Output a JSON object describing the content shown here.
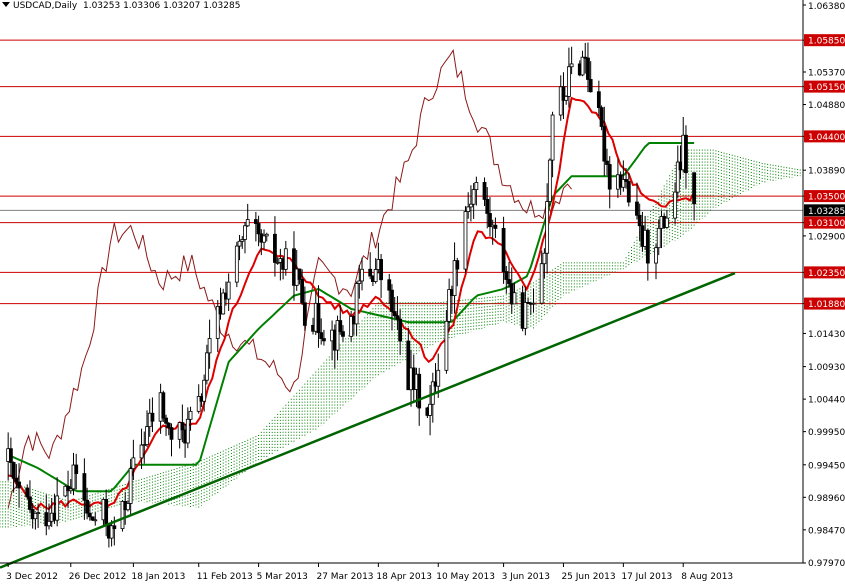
{
  "header": {
    "symbol": "USDCAD,Daily",
    "ohlc": "1.03253 1.03306 1.03207 1.03285"
  },
  "chart_data": {
    "type": "candlestick",
    "title": "USDCAD,Daily",
    "ylim": [
      0.9797,
      1.0638
    ],
    "price_ticks": [
      "1.06380",
      "1.05850",
      "1.05370",
      "1.05150",
      "1.04880",
      "1.04400",
      "1.03890",
      "1.03500",
      "1.03285",
      "1.03100",
      "1.02900",
      "1.02350",
      "1.01880",
      "1.01430",
      "1.00930",
      "1.00440",
      "0.99950",
      "0.99450",
      "0.98960",
      "0.98470",
      "0.97970"
    ],
    "date_ticks": [
      "3 Dec 2012",
      "26 Dec 2012",
      "18 Jan 2013",
      "11 Feb 2013",
      "5 Mar 2013",
      "27 Mar 2013",
      "18 Apr 2013",
      "10 May 2013",
      "3 Jun 2013",
      "25 Jun 2013",
      "17 Jul 2013",
      "8 Aug 2013"
    ],
    "horizontal_levels": [
      {
        "price": 1.0585,
        "label": "1.05850"
      },
      {
        "price": 1.0515,
        "label": "1.05150"
      },
      {
        "price": 1.044,
        "label": "1.04400"
      },
      {
        "price": 1.035,
        "label": "1.03500"
      },
      {
        "price": 1.031,
        "label": "1.03100"
      },
      {
        "price": 1.0235,
        "label": "1.02350"
      },
      {
        "price": 1.0188,
        "label": "1.01880"
      }
    ],
    "current_price": {
      "price": 1.03285,
      "label": "1.03285"
    },
    "trendline": [
      {
        "date": "30 Nov 2012",
        "price": 0.979
      },
      {
        "date": "27 Aug 2013",
        "price": 1.0234
      }
    ],
    "candles_anchor_close": [
      [
        "3 Dec 2012",
        0.995
      ],
      [
        "6 Dec 2012",
        0.9905
      ],
      [
        "11 Dec 2012",
        0.987
      ],
      [
        "14 Dec 2012",
        0.986
      ],
      [
        "19 Dec 2012",
        0.988
      ],
      [
        "26 Dec 2012",
        0.9915
      ],
      [
        "28 Dec 2012",
        0.993
      ],
      [
        "2 Jan 2013",
        0.986
      ],
      [
        "7 Jan 2013",
        0.987
      ],
      [
        "10 Jan 2013",
        0.984
      ],
      [
        "14 Jan 2013",
        0.987
      ],
      [
        "18 Jan 2013",
        0.994
      ],
      [
        "23 Jan 2013",
        1.0
      ],
      [
        "28 Jan 2013",
        1.004
      ],
      [
        "31 Jan 2013",
        0.999
      ],
      [
        "5 Feb 2013",
        0.999
      ],
      [
        "11 Feb 2013",
        1.003
      ],
      [
        "15 Feb 2013",
        1.012
      ],
      [
        "20 Feb 2013",
        1.02
      ],
      [
        "26 Feb 2013",
        1.027
      ],
      [
        "1 Mar 2013",
        1.03
      ],
      [
        "5 Mar 2013",
        1.028
      ],
      [
        "8 Mar 2013",
        1.027
      ],
      [
        "13 Mar 2013",
        1.025
      ],
      [
        "18 Mar 2013",
        1.024
      ],
      [
        "22 Mar 2013",
        1.018
      ],
      [
        "27 Mar 2013",
        1.016
      ],
      [
        "2 Apr 2013",
        1.014
      ],
      [
        "8 Apr 2013",
        1.016
      ],
      [
        "12 Apr 2013",
        1.023
      ],
      [
        "18 Apr 2013",
        1.024
      ],
      [
        "23 Apr 2013",
        1.018
      ],
      [
        "29 Apr 2013",
        1.008
      ],
      [
        "3 May 2013",
        1.005
      ],
      [
        "7 May 2013",
        1.003
      ],
      [
        "10 May 2013",
        1.01
      ],
      [
        "15 May 2013",
        1.022
      ],
      [
        "20 May 2013",
        1.033
      ],
      [
        "24 May 2013",
        1.037
      ],
      [
        "29 May 2013",
        1.031
      ],
      [
        "3 Jun 2013",
        1.025
      ],
      [
        "7 Jun 2013",
        1.018
      ],
      [
        "12 Jun 2013",
        1.017
      ],
      [
        "18 Jun 2013",
        1.028
      ],
      [
        "21 Jun 2013",
        1.048
      ],
      [
        "25 Jun 2013",
        1.05
      ],
      [
        "28 Jun 2013",
        1.054
      ],
      [
        "3 Jul 2013",
        1.056
      ],
      [
        "9 Jul 2013",
        1.044
      ],
      [
        "12 Jul 2013",
        1.038
      ],
      [
        "17 Jul 2013",
        1.038
      ],
      [
        "22 Jul 2013",
        1.03
      ],
      [
        "26 Jul 2013",
        1.027
      ],
      [
        "31 Jul 2013",
        1.03
      ],
      [
        "5 Aug 2013",
        1.036
      ],
      [
        "8 Aug 2013",
        1.042
      ],
      [
        "12 Aug 2013",
        1.0328
      ]
    ],
    "tenkan_anchors": [
      [
        "3 Dec 2012",
        0.993
      ],
      [
        "14 Dec 2012",
        0.988
      ],
      [
        "28 Dec 2012",
        0.989
      ],
      [
        "10 Jan 2013",
        0.988
      ],
      [
        "18 Jan 2013",
        0.993
      ],
      [
        "28 Jan 2013",
        1.0
      ],
      [
        "11 Feb 2013",
        1.001
      ],
      [
        "22 Feb 2013",
        1.016
      ],
      [
        "5 Mar 2013",
        1.027
      ],
      [
        "18 Mar 2013",
        1.025
      ],
      [
        "27 Mar 2013",
        1.02
      ],
      [
        "8 Apr 2013",
        1.017
      ],
      [
        "18 Apr 2013",
        1.02
      ],
      [
        "29 Apr 2013",
        1.015
      ],
      [
        "7 May 2013",
        1.01
      ],
      [
        "15 May 2013",
        1.015
      ],
      [
        "24 May 2013",
        1.03
      ],
      [
        "3 Jun 2013",
        1.027
      ],
      [
        "12 Jun 2013",
        1.021
      ],
      [
        "21 Jun 2013",
        1.033
      ],
      [
        "28 Jun 2013",
        1.05
      ],
      [
        "9 Jul 2013",
        1.047
      ],
      [
        "17 Jul 2013",
        1.039
      ],
      [
        "26 Jul 2013",
        1.034
      ],
      [
        "5 Aug 2013",
        1.034
      ],
      [
        "12 Aug 2013",
        1.035
      ]
    ],
    "kijun_anchors": [
      [
        "3 Dec 2012",
        0.996
      ],
      [
        "14 Dec 2012",
        0.994
      ],
      [
        "28 Dec 2012",
        0.9905
      ],
      [
        "10 Jan 2013",
        0.9905
      ],
      [
        "18 Jan 2013",
        0.9945
      ],
      [
        "11 Feb 2013",
        0.9945
      ],
      [
        "22 Feb 2013",
        1.01
      ],
      [
        "5 Mar 2013",
        1.015
      ],
      [
        "18 Mar 2013",
        1.02
      ],
      [
        "27 Mar 2013",
        1.021
      ],
      [
        "8 Apr 2013",
        1.018
      ],
      [
        "29 Apr 2013",
        1.016
      ],
      [
        "15 May 2013",
        1.016
      ],
      [
        "24 May 2013",
        1.02
      ],
      [
        "3 Jun 2013",
        1.021
      ],
      [
        "12 Jun 2013",
        1.023
      ],
      [
        "21 Jun 2013",
        1.035
      ],
      [
        "28 Jun 2013",
        1.038
      ],
      [
        "9 Jul 2013",
        1.038
      ],
      [
        "17 Jul 2013",
        1.038
      ],
      [
        "26 Jul 2013",
        1.043
      ],
      [
        "12 Aug 2013",
        1.043
      ]
    ],
    "chikou_anchors": [
      [
        "3 Dec 2012",
        0.988
      ],
      [
        "10 Dec 2012",
        0.999
      ],
      [
        "19 Dec 2012",
        0.996
      ],
      [
        "31 Dec 2012",
        1.01
      ],
      [
        "10 Jan 2013",
        1.029
      ],
      [
        "18 Jan 2013",
        1.03
      ],
      [
        "28 Jan 2013",
        1.022
      ],
      [
        "8 Feb 2013",
        1.025
      ],
      [
        "20 Feb 2013",
        1.015
      ],
      [
        "5 Mar 2013",
        1.011
      ],
      [
        "18 Mar 2013",
        1.006
      ],
      [
        "27 Mar 2013",
        1.024
      ],
      [
        "8 Apr 2013",
        1.021
      ],
      [
        "18 Apr 2013",
        1.03
      ],
      [
        "29 Apr 2013",
        1.04
      ],
      [
        "7 May 2013",
        1.051
      ],
      [
        "15 May 2013",
        1.056
      ],
      [
        "24 May 2013",
        1.047
      ],
      [
        "3 Jun 2013",
        1.038
      ],
      [
        "12 Jun 2013",
        1.033
      ],
      [
        "21 Jun 2013",
        1.034
      ],
      [
        "28 Jun 2013",
        1.038
      ]
    ],
    "cloud_anchors": [
      [
        "3 Dec 2012",
        0.992,
        0.985
      ],
      [
        "26 Dec 2012",
        0.989,
        0.986
      ],
      [
        "18 Jan 2013",
        0.992,
        0.989
      ],
      [
        "11 Feb 2013",
        0.995,
        0.988
      ],
      [
        "5 Mar 2013",
        0.999,
        0.995
      ],
      [
        "27 Mar 2013",
        1.009,
        1.0
      ],
      [
        "18 Apr 2013",
        1.019,
        1.008
      ],
      [
        "10 May 2013",
        1.019,
        1.013
      ],
      [
        "3 Jun 2013",
        1.02,
        1.016
      ],
      [
        "14 Jun 2013",
        1.022,
        1.015
      ],
      [
        "25 Jun 2013",
        1.025,
        1.02
      ],
      [
        "17 Jul 2013",
        1.025,
        1.024
      ],
      [
        "8 Aug 2013",
        1.042,
        1.029
      ],
      [
        "19 Aug 2013",
        1.042,
        1.033
      ],
      [
        "6 Sep 2013",
        1.04,
        1.037
      ],
      [
        "20 Sep 2013",
        1.039,
        1.038
      ]
    ]
  }
}
